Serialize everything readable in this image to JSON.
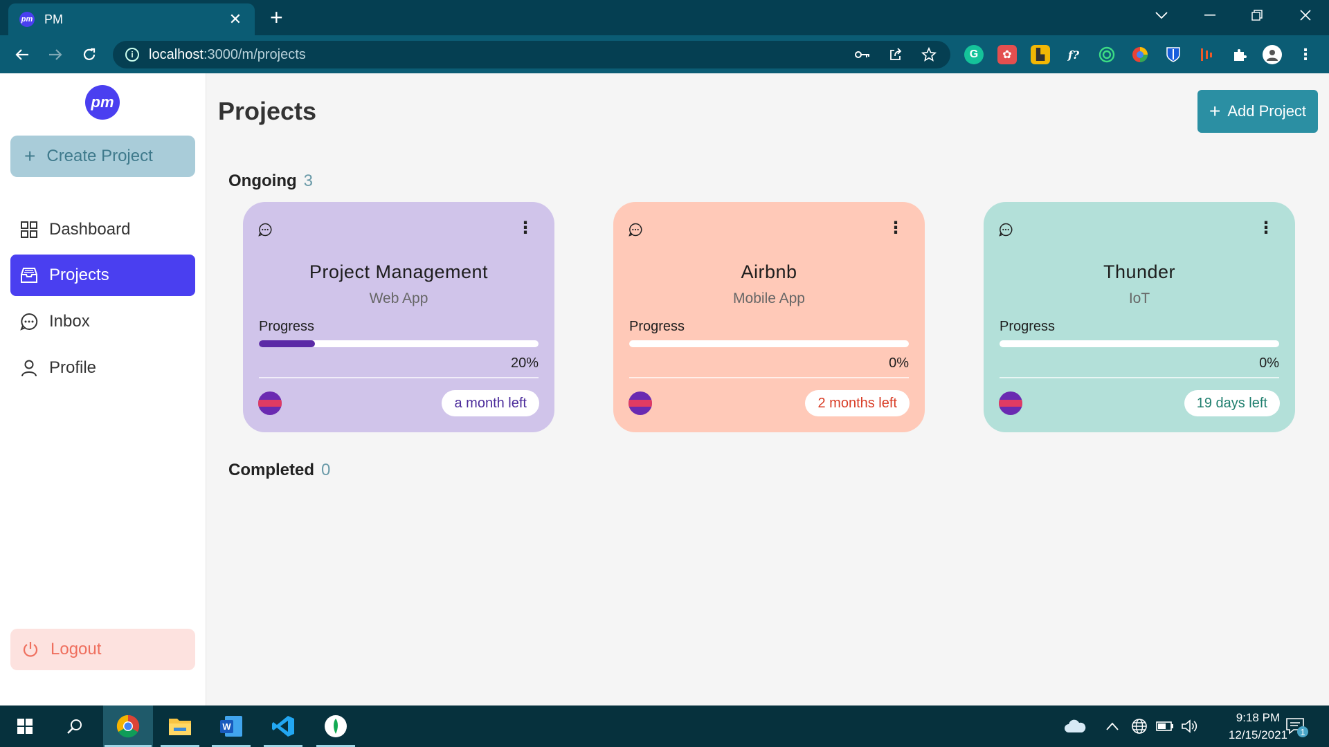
{
  "browser": {
    "tab_title": "PM",
    "favicon_text": "pm",
    "url_host": "localhost",
    "url_path": ":3000/m/projects",
    "extension_icons": [
      "grammarly-icon",
      "extension-red-icon",
      "extension-yellow-icon",
      "whatfont-icon",
      "extension-target-icon",
      "extension-color-icon",
      "bitwarden-icon",
      "extension-bars-icon",
      "puzzle-icon",
      "profile-icon"
    ]
  },
  "sidebar": {
    "logo_text": "pm",
    "create_label": "Create Project",
    "items": [
      {
        "label": "Dashboard",
        "icon": "grid-icon"
      },
      {
        "label": "Projects",
        "icon": "folder-icon"
      },
      {
        "label": "Inbox",
        "icon": "chat-icon"
      },
      {
        "label": "Profile",
        "icon": "user-icon"
      }
    ],
    "active_item": "Projects",
    "logout_label": "Logout"
  },
  "main": {
    "title": "Projects",
    "add_label": "Add Project",
    "ongoing": {
      "label": "Ongoing",
      "count": "3"
    },
    "completed": {
      "label": "Completed",
      "count": "0"
    },
    "cards": [
      {
        "name": "Project Management",
        "type": "Web App",
        "progress_label": "Progress",
        "progress": 20,
        "progress_text": "20%",
        "due": "a month left",
        "bg": "#d0c4ea",
        "bar": "#5b2aa6",
        "due_color": "#4a2a9a"
      },
      {
        "name": "Airbnb",
        "type": "Mobile App",
        "progress_label": "Progress",
        "progress": 0,
        "progress_text": "0%",
        "due": "2 months left",
        "bg": "#ffc9b8",
        "bar": "#e0452d",
        "due_color": "#d83c25"
      },
      {
        "name": "Thunder",
        "type": "IoT",
        "progress_label": "Progress",
        "progress": 0,
        "progress_text": "0%",
        "due": "19 days left",
        "bg": "#b3e0d9",
        "bar": "#2b8f7d",
        "due_color": "#1f7f6e"
      }
    ]
  },
  "taskbar": {
    "time": "9:18 PM",
    "date": "12/15/2021",
    "notification_count": "1"
  }
}
